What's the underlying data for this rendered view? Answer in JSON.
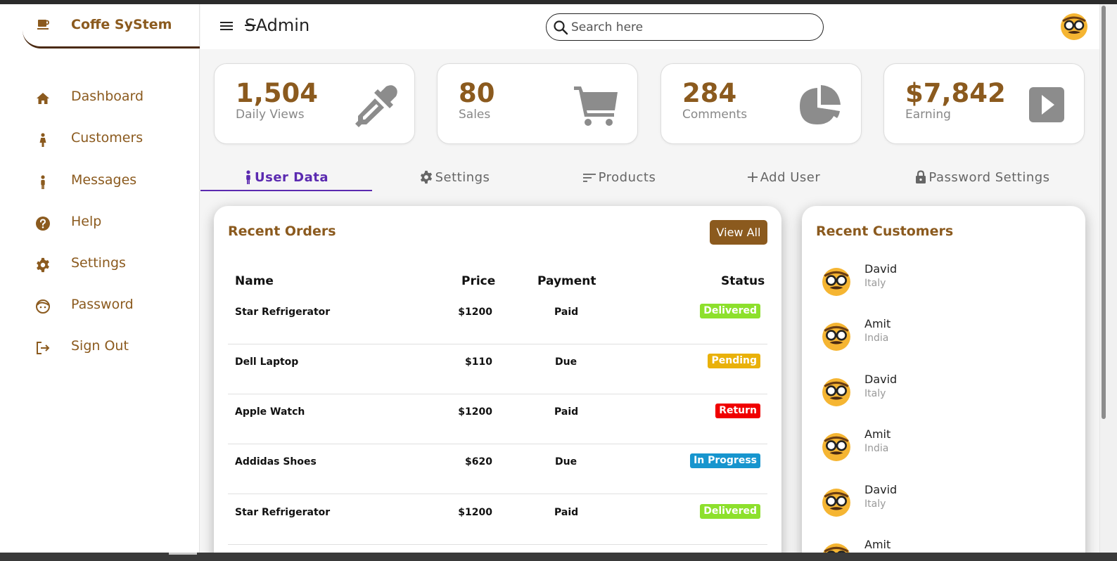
{
  "brand": {
    "name": "Coffe SyStem",
    "icon": "coffee-cup-icon"
  },
  "sidebar": {
    "items": [
      {
        "label": "Dashboard",
        "icon": "home-icon"
      },
      {
        "label": "Customers",
        "icon": "person-icon"
      },
      {
        "label": "Messages",
        "icon": "person-icon"
      },
      {
        "label": "Help",
        "icon": "help-circle-icon"
      },
      {
        "label": "Settings",
        "icon": "gear-icon"
      },
      {
        "label": "Password",
        "icon": "face-icon"
      },
      {
        "label": "Sign Out",
        "icon": "sign-out-icon"
      }
    ]
  },
  "header": {
    "title": "Admin",
    "search": {
      "placeholder": "Search here",
      "value": ""
    }
  },
  "stats": [
    {
      "value": "1,504",
      "label": "Daily Views",
      "icon": "eyedropper-icon"
    },
    {
      "value": "80",
      "label": "Sales",
      "icon": "cart-icon"
    },
    {
      "value": "284",
      "label": "Comments",
      "icon": "pie-chart-icon"
    },
    {
      "value": "$7,842",
      "label": "Earning",
      "icon": "play-icon"
    }
  ],
  "tabs": [
    {
      "label": "User Data",
      "icon": "person-icon",
      "active": true
    },
    {
      "label": "Settings",
      "icon": "gear-icon",
      "active": false
    },
    {
      "label": "Products",
      "icon": "sort-lines-icon",
      "active": false
    },
    {
      "label": "Add User",
      "icon": "plus-icon",
      "active": false
    },
    {
      "label": "Password Settings",
      "icon": "lock-icon",
      "active": false
    }
  ],
  "orders": {
    "title": "Recent Orders",
    "view_all": "View All",
    "columns": [
      "Name",
      "Price",
      "Payment",
      "Status"
    ],
    "rows": [
      {
        "name": "Star Refrigerator",
        "price": "$1200",
        "payment": "Paid",
        "status": "Delivered",
        "status_color": "#8de02c"
      },
      {
        "name": "Dell Laptop",
        "price": "$110",
        "payment": "Due",
        "status": "Pending",
        "status_color": "#e9b10a"
      },
      {
        "name": "Apple Watch",
        "price": "$1200",
        "payment": "Paid",
        "status": "Return",
        "status_color": "#f00000"
      },
      {
        "name": "Addidas Shoes",
        "price": "$620",
        "payment": "Due",
        "status": "In Progress",
        "status_color": "#1795ce"
      },
      {
        "name": "Star Refrigerator",
        "price": "$1200",
        "payment": "Paid",
        "status": "Delivered",
        "status_color": "#8de02c"
      }
    ]
  },
  "customers": {
    "title": "Recent Customers",
    "items": [
      {
        "name": "David",
        "country": "Italy"
      },
      {
        "name": "Amit",
        "country": "India"
      },
      {
        "name": "David",
        "country": "Italy"
      },
      {
        "name": "Amit",
        "country": "India"
      },
      {
        "name": "David",
        "country": "Italy"
      },
      {
        "name": "Amit",
        "country": ""
      }
    ]
  },
  "colors": {
    "brand": "#8b5a1e",
    "accent": "#5b2ab0",
    "icon_gray": "#8c8c8c"
  }
}
